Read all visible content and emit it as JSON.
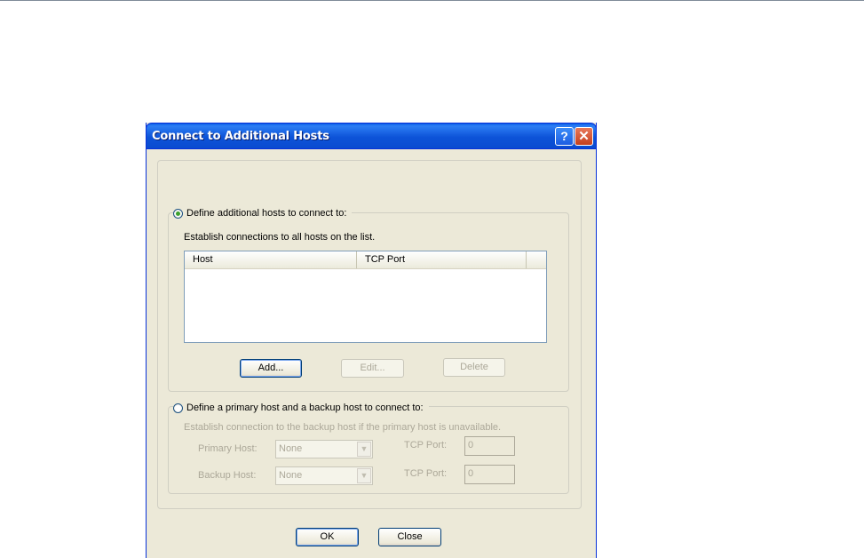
{
  "dialog": {
    "title": "Connect to Additional Hosts",
    "help_glyph": "?",
    "close_glyph": "✕"
  },
  "option1": {
    "label": "Define additional hosts to connect to:",
    "selected": true,
    "description": "Establish connections to all hosts on the list.",
    "columns": [
      "Host",
      "TCP Port"
    ],
    "rows": [],
    "add_label": "Add...",
    "edit_label": "Edit...",
    "delete_label": "Delete"
  },
  "option2": {
    "label": "Define a primary host and a backup host to connect to:",
    "selected": false,
    "description": "Establish connection to the backup host if the primary host is unavailable.",
    "primary_label": "Primary Host:",
    "primary_value": "None",
    "backup_label": "Backup Host:",
    "backup_value": "None",
    "tcp_label_1": "TCP Port:",
    "tcp_value_1": "0",
    "tcp_label_2": "TCP Port:",
    "tcp_value_2": "0"
  },
  "footer": {
    "ok_label": "OK",
    "close_label": "Close"
  },
  "colors": {
    "titlebar": "#0a53d8",
    "dialog_bg": "#ece9d8",
    "disabled_text": "#aca899"
  },
  "icons": {
    "help": "help-icon",
    "close": "close-icon",
    "combo_arrow": "chevron-down-icon"
  }
}
